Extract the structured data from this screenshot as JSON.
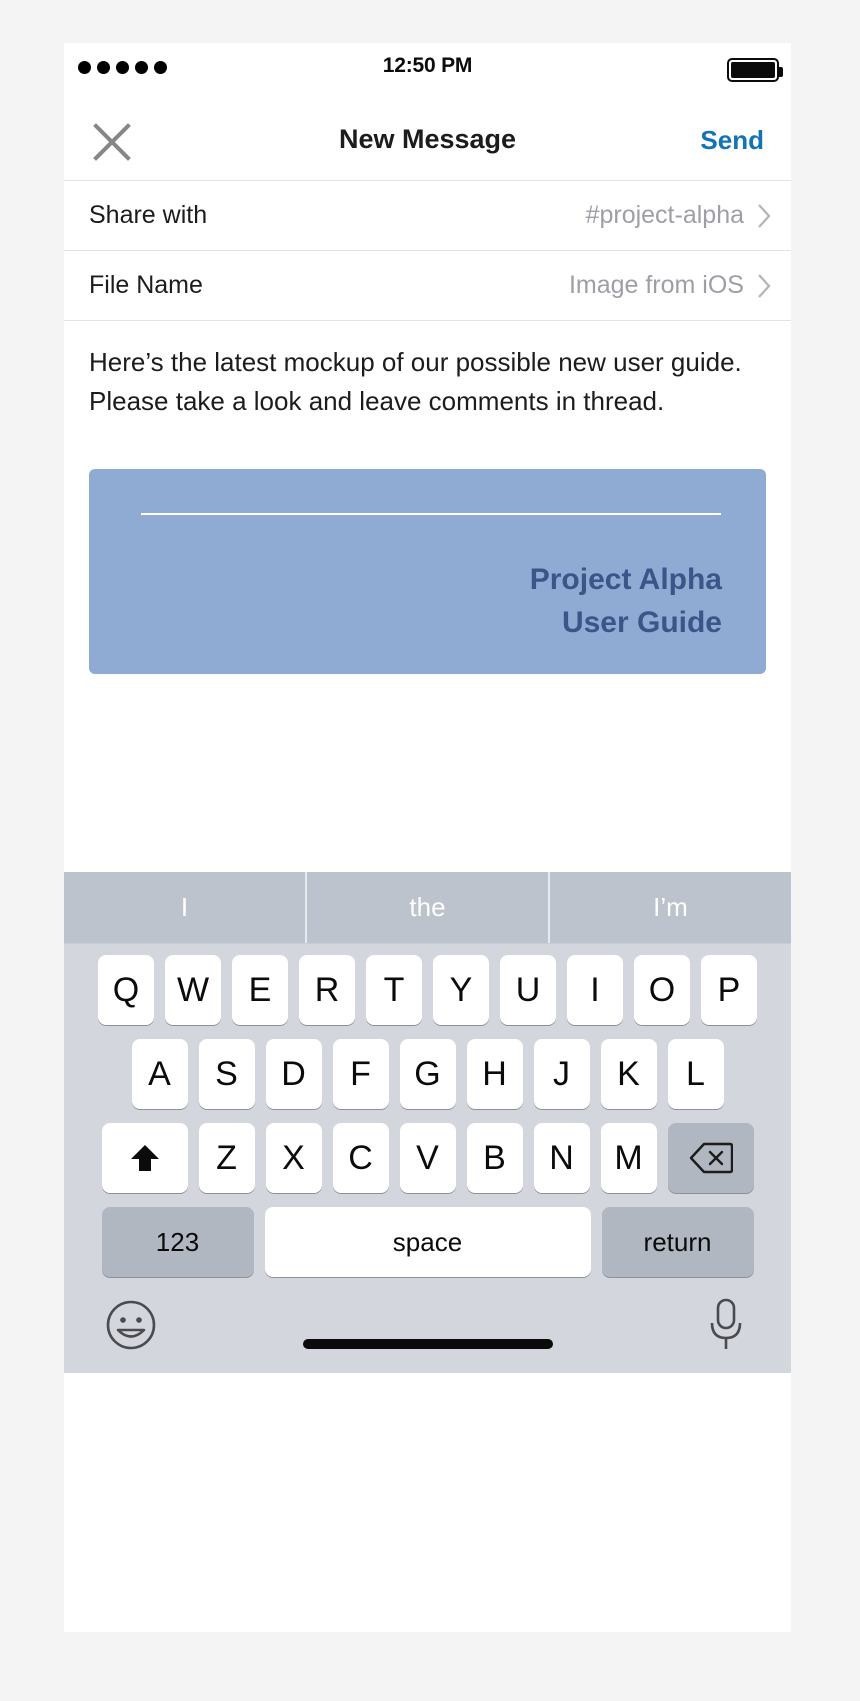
{
  "status_bar": {
    "signal_dots": 5,
    "time": "12:50 PM",
    "battery_icon": "battery-full-icon"
  },
  "nav_bar": {
    "close_icon": "close-icon",
    "title": "New Message",
    "send_label": "Send",
    "send_color": "#1273b5"
  },
  "fields": [
    {
      "label": "Share with",
      "value": "#project-alpha",
      "chevron_icon": "chevron-right-icon"
    },
    {
      "label": "File Name",
      "value": "Image from iOS",
      "chevron_icon": "chevron-right-icon"
    }
  ],
  "message": {
    "body": "Here’s the latest mockup of our possible new user guide. Please take a look and leave comments in thread."
  },
  "attachment": {
    "card_bg": "#8fabd4",
    "title_color": "#3d5489",
    "rule_color": "#ffffff",
    "title_line1": "Project Alpha",
    "title_line2": "User Guide"
  },
  "keyboard": {
    "suggestions": [
      "I",
      "the",
      "I’m"
    ],
    "row1": [
      "Q",
      "W",
      "E",
      "R",
      "T",
      "Y",
      "U",
      "I",
      "O",
      "P"
    ],
    "row2": [
      "A",
      "S",
      "D",
      "F",
      "G",
      "H",
      "J",
      "K",
      "L"
    ],
    "row3_letters": [
      "Z",
      "X",
      "C",
      "V",
      "B",
      "N",
      "M"
    ],
    "shift_icon": "shift-arrow-icon",
    "backspace_icon": "backspace-icon",
    "numbers_label": "123",
    "space_label": "space",
    "return_label": "return",
    "emoji_icon": "emoji-smiley-icon",
    "mic_icon": "microphone-icon",
    "bg_color": "#d3d6dc",
    "suggestion_bg": "#bcc3cc",
    "fn_key_bg": "#b0b7c1"
  },
  "home_indicator": {
    "color": "#0b0b0b"
  }
}
